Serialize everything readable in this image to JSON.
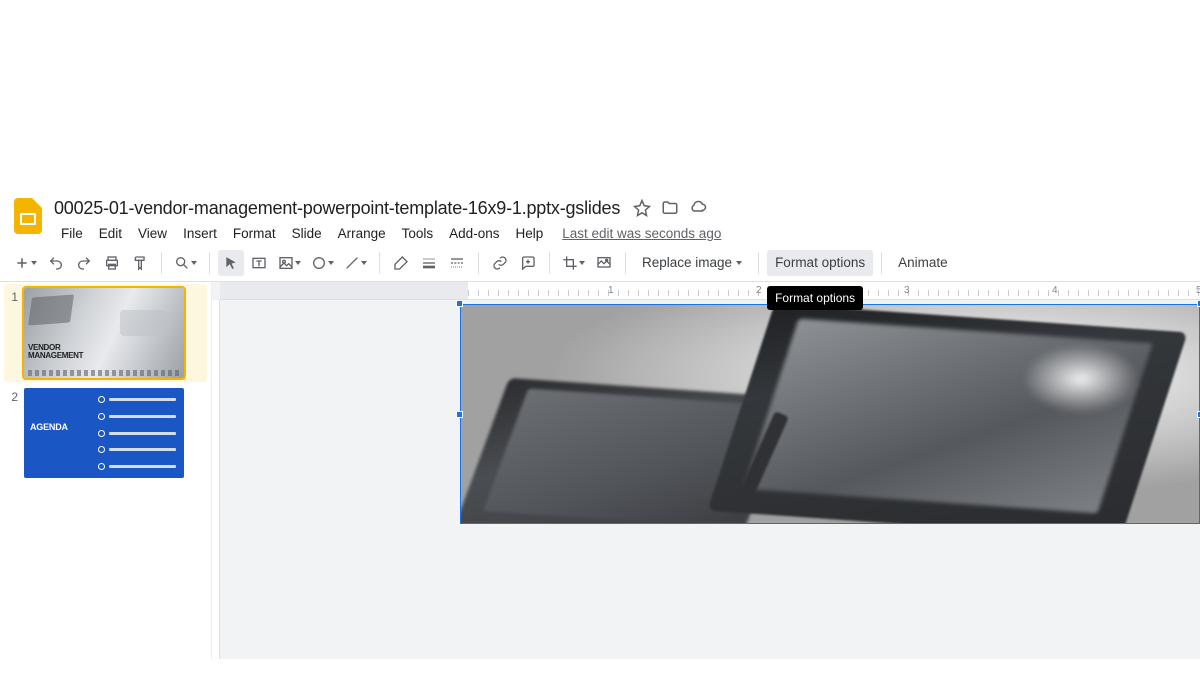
{
  "doc": {
    "title": "00025-01-vendor-management-powerpoint-template-16x9-1.pptx-gslides",
    "last_edit": "Last edit was seconds ago"
  },
  "menus": [
    "File",
    "Edit",
    "View",
    "Insert",
    "Format",
    "Slide",
    "Arrange",
    "Tools",
    "Add-ons",
    "Help"
  ],
  "toolbar": {
    "replace_image": "Replace image",
    "format_options": "Format options",
    "animate": "Animate",
    "tooltip_format_options": "Format options"
  },
  "ruler": {
    "majors": [
      "1",
      "2",
      "3",
      "4",
      "5"
    ]
  },
  "slides": [
    {
      "num": "1",
      "title_a": "VENDOR",
      "title_b": "MANAGEMENT"
    },
    {
      "num": "2",
      "title": "AGENDA"
    }
  ]
}
